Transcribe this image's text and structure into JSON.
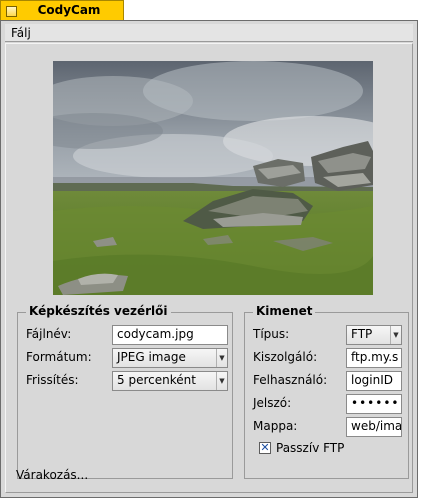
{
  "window": {
    "title": "CodyCam"
  },
  "menu": {
    "file_label": "Fálj"
  },
  "capture": {
    "legend": "Képkészítés vezérlői",
    "filename_label": "Fájlnév:",
    "filename_value": "codycam.jpg",
    "format_label": "Formátum:",
    "format_value": "JPEG image",
    "refresh_label": "Frissítés:",
    "refresh_value": "5 percenként"
  },
  "output": {
    "legend": "Kimenet",
    "type_label": "Típus:",
    "type_value": "FTP",
    "server_label": "Kiszolgáló:",
    "server_value": "ftp.my.s",
    "user_label": "Felhasználó:",
    "user_value": "loginID",
    "password_label": "Jelszó:",
    "password_value": "••••••",
    "folder_label": "Mappa:",
    "folder_value": "web/ima",
    "passive_label": "Passzív FTP",
    "passive_checked": true
  },
  "status": {
    "text": "Várakozás..."
  },
  "colors": {
    "tab_accent": "#ffcb00",
    "window_bg": "#d8d8d8"
  },
  "icons": {
    "zoom": "zoom-box-icon",
    "dropdown": "dropdown-arrow-icon",
    "checkmark": "checkmark-icon"
  }
}
